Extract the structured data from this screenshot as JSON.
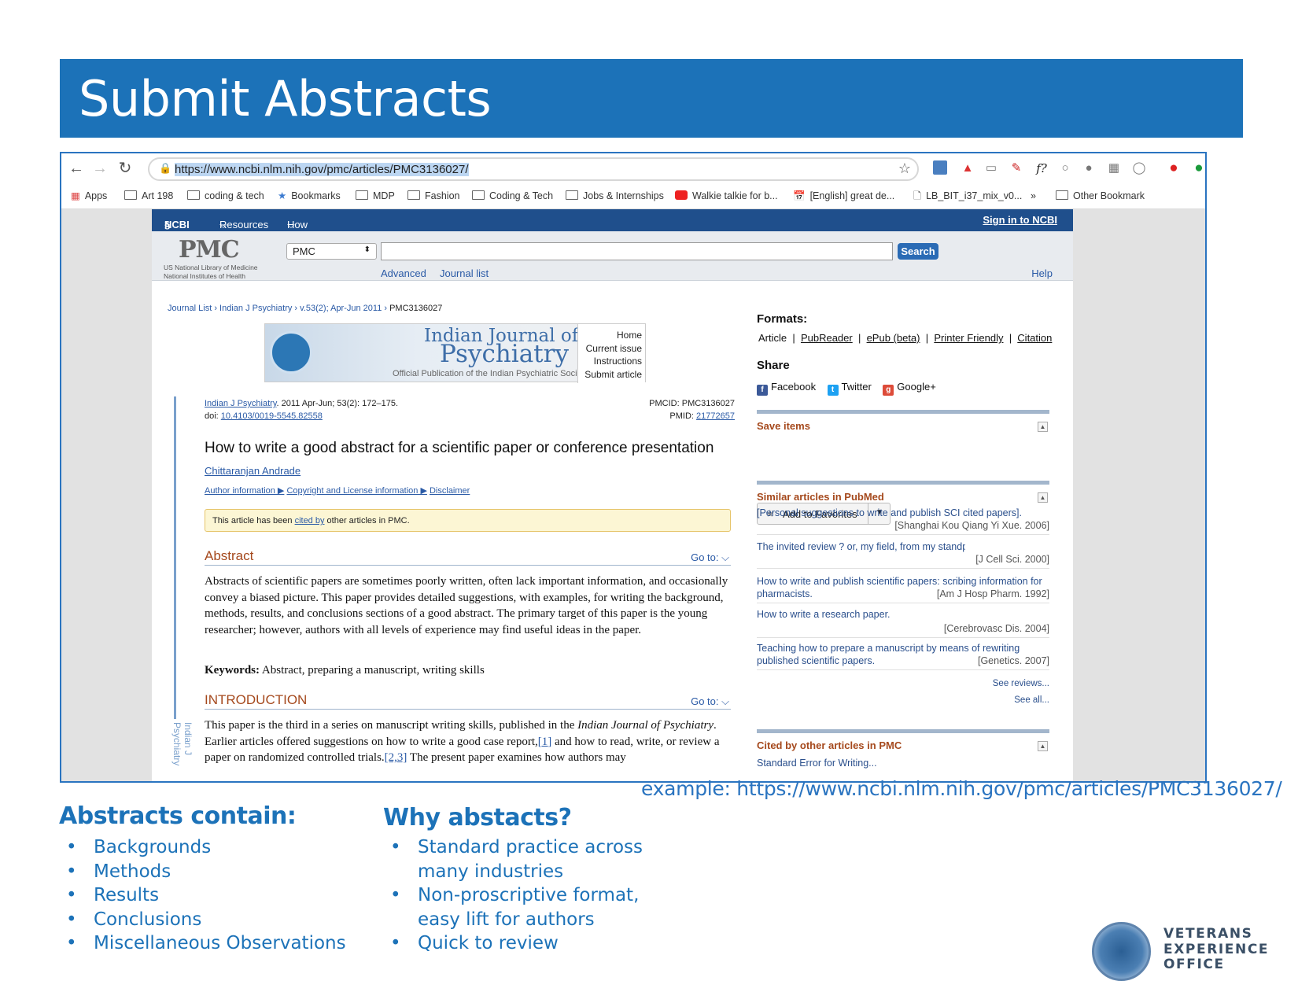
{
  "slide": {
    "title": "Submit Abstracts",
    "caption": "example: https://www.ncbi.nlm.nih.gov/pmc/articles/PMC3136027/",
    "left_heading": "Abstracts contain:",
    "left_items": [
      "Backgrounds",
      "Methods",
      "Results",
      "Conclusions",
      "Miscellaneous Observations"
    ],
    "right_heading": "Why abstacts?",
    "right_items": [
      "Standard practice across",
      "many industries",
      "Non-proscriptive format,",
      "easy lift for authors",
      "Quick to review"
    ],
    "logo_lines": [
      "VETERANS",
      "EXPERIENCE",
      "OFFICE"
    ]
  },
  "browser": {
    "url": "https://www.ncbi.nlm.nih.gov/pmc/articles/PMC3136027/",
    "ext_f": "f?",
    "bookmarks": [
      "Apps",
      "Art 198",
      "coding & tech",
      "Bookmarks",
      "MDP",
      "Fashion",
      "Coding & Tech",
      "Jobs & Internships",
      "Walkie talkie for b...",
      "[English] great de...",
      "LB_BIT_i37_mix_v0...",
      "»",
      "Other Bookmark"
    ]
  },
  "ncbi": {
    "logo": "NCBI",
    "resources": "Resources",
    "howto": "How To",
    "signin": "Sign in to NCBI",
    "pmc_logo": "PMC",
    "pmc_sub1": "US National Library of Medicine",
    "pmc_sub2": "National Institutes of Health",
    "db": "PMC",
    "search": "Search",
    "advanced": "Advanced",
    "journal_list": "Journal list",
    "help": "Help"
  },
  "article": {
    "crumbs": [
      "Journal List",
      "Indian J Psychiatry",
      "v.53(2); Apr-Jun 2011"
    ],
    "crumb_current": "PMC3136027",
    "journal_title1": "Indian Journal of",
    "journal_title2": "Psychiatry",
    "journal_tag": "Official Publication of the Indian Psychiatric Society",
    "journal_links": [
      "Home",
      "Current issue",
      "Instructions",
      "Submit article"
    ],
    "side_label": "Indian J Psychiatry",
    "cite_journal": "Indian J Psychiatry",
    "cite_rest": ". 2011 Apr-Jun; 53(2): 172–175.",
    "doi_label": "doi: ",
    "doi": "10.4103/0019-5545.82558",
    "pmcid": "PMCID: PMC3136027",
    "pmid_label": "PMID: ",
    "pmid": "21772657",
    "title": "How to write a good abstract for a scientific paper or conference presentation",
    "author": "Chittaranjan Andrade",
    "info1": "Author information ▶",
    "info2": "Copyright and License information ▶",
    "info3": "Disclaimer",
    "notice_pre": "This article has been ",
    "notice_link": "cited by",
    "notice_post": " other articles in PMC.",
    "abstract_heading": "Abstract",
    "goto": "Go to:",
    "abstract_text": "Abstracts of scientific papers are sometimes poorly written, often lack important information, and occasionally convey a biased picture. This paper provides detailed suggestions, with examples, for writing the background, methods, results, and conclusions sections of a good abstract. The primary target of this paper is the young researcher; however, authors with all levels of experience may find useful ideas in the paper.",
    "keywords_label": "Keywords:",
    "keywords": " Abstract, preparing a manuscript, writing skills",
    "intro_heading": "INTRODUCTION",
    "intro_a": "This paper is the third in a series on manuscript writing skills, published in the ",
    "intro_journal": "Indian Journal of Psychiatry",
    "intro_b": ". Earlier articles offered suggestions on how to write a good case report,",
    "ref1": "[1]",
    "intro_c": " and how to read, write, or review a paper on randomized controlled trials.",
    "ref2": "[2,3]",
    "intro_d": " The present paper examines how authors may"
  },
  "sidebar": {
    "formats_label": "Formats:",
    "formats": [
      "Article",
      "PubReader",
      "ePub (beta)",
      "Printer Friendly",
      "Citation"
    ],
    "share_label": "Share",
    "share": [
      "Facebook",
      "Twitter",
      "Google+"
    ],
    "save_label": "Save items",
    "fav": "Add to Favorites",
    "similar_label": "Similar articles in PubMed",
    "similar": [
      {
        "title": "[Personal suggestions to write and publish SCI cited papers].",
        "src": "[Shanghai Kou Qiang Yi Xue. 2006]"
      },
      {
        "title": "The invited review ? or, my field, from my standpoint, written by me using only my data and my ideas, and citing o",
        "src": "[J Cell Sci. 2000]"
      },
      {
        "title": "How to write and publish scientific papers: scribing information for pharmacists.",
        "src": "[Am J Hosp Pharm. 1992]"
      },
      {
        "title": "How to write a research paper.",
        "src": "[Cerebrovasc Dis. 2004]"
      },
      {
        "title": "Teaching how to prepare a manuscript by means of rewriting published scientific papers.",
        "src": "[Genetics. 2007]"
      }
    ],
    "see_reviews": "See reviews...",
    "see_all": "See all...",
    "cited_label": "Cited by other articles in PMC",
    "cited_first": "Standard Error for Writing..."
  }
}
